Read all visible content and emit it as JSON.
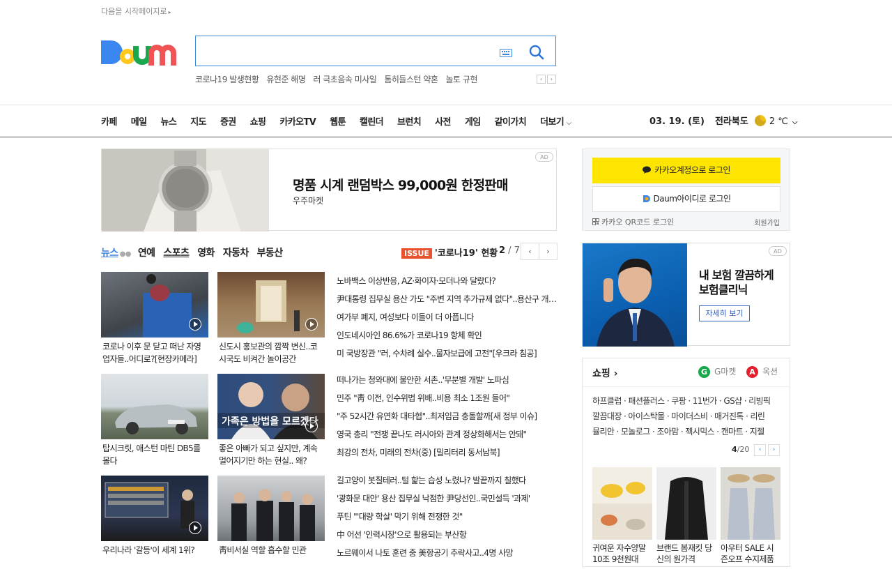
{
  "top": {
    "startpage_link": "다음을 시작페이지로"
  },
  "logo": {
    "text": "Daum"
  },
  "search": {
    "value": "",
    "trending": [
      "코로나19 발생현황",
      "유현준 해명",
      "러 극초음속 미사일",
      "톰히들스턴 약혼",
      "놀토 규현"
    ]
  },
  "gnb": {
    "items": [
      "카페",
      "메일",
      "뉴스",
      "지도",
      "증권",
      "쇼핑",
      "카카오TV",
      "웹툰",
      "캘린더",
      "브런치",
      "사전",
      "게임",
      "같이가치"
    ],
    "more_label": "더보기",
    "date": "03. 19. (토)",
    "region": "전라북도",
    "temp": "2 ℃"
  },
  "banner": {
    "title": "명품 시계 랜덤박스 99,000원 한정판매",
    "sub": "우주마켓",
    "ad_label": "AD"
  },
  "news_tabs": {
    "items": [
      "뉴스",
      "연예",
      "스포츠",
      "영화",
      "자동차",
      "부동산"
    ],
    "issue_badge": "ISSUE",
    "issue_text": "'코로나19' 현황",
    "page_current": "2",
    "page_total": " / 7"
  },
  "thumbs": [
    {
      "caption": "코로나 이후 문 닫고 떠난 자영업자들..어디로?[현장카메라]"
    },
    {
      "caption": "신도시 홍보관의 깜짝 변신..코시국도 비켜간 놀이공간"
    },
    {
      "caption": "탑시크릿, 애스턴 마틴 DB5를 몰다"
    },
    {
      "caption": "좋은 아빠가 되고 싶지만, 계속 멀어지기만 하는 현실.. 왜?"
    },
    {
      "caption": "우리나라 '갈등'이 세계 1위?"
    },
    {
      "caption": "靑비서실 역할 흡수할 민관"
    }
  ],
  "headlines": {
    "group1": [
      "노바백스 이상반응, AZ·화이자·모더나와 달랐다?",
      "尹대통령 집무실 용산 가도 \"주변 지역 추가규제 없다\"..용산구 개발 기대",
      "여가부 폐지, 여성보다 이들이 더 아픕니다",
      "인도네시아인 86.6%가 코로나19 항체 확인",
      "미 국방장관 \"러, 수차례 실수..물자보급에 고전\"[우크라 침공]"
    ],
    "group2": [
      "떠나가는 청와대에 불안한 서촌..'무분별 개발' 노파심",
      "민주 \"靑 이전, 인수위법 위배..비용 최소 1조원 들어\"",
      "\"주 52시간 유연화 대타협\"..최저임금 충돌할까[새 정부 이슈]",
      "영국 총리 \"전쟁 끝나도 러시아와 관계 정상화해서는 안돼\"",
      "최강의 전차, 미래의 전차(중) [밀리터리 동서남북]"
    ],
    "group3": [
      "길고양이 봇질테러..털 핥는 습성 노렸나? 발끝까지 칠했다",
      "'광화문 대안' 용산 집무실 낙점한 尹당선인..국민설득 '과제'",
      "푸틴 \"'대량 학살' 막기 위해 전쟁한 것\"",
      "中 어선 '인력시장'으로 활용되는 부산항",
      "노르웨이서 나토 훈련 중 美항공기 추락사고..4명 사망"
    ]
  },
  "login": {
    "kakao_label": "카카오계정으로 로그인",
    "daum_label": "Daum아이디로 로그인",
    "qr_label": "카카오 QR코드 로그인",
    "signup_label": "회원가입"
  },
  "ins_ad": {
    "title": "내 보험 깔끔하게 보험클리닉",
    "button": "자세히 보기",
    "ad_label": "AD"
  },
  "shopping": {
    "title": "쇼핑",
    "gmarket": "G마켓",
    "auction": "옥션",
    "line1": "하프클럽 · 패션플러스 · 쿠팡 · 11번가 · GS샵 · 리빙픽",
    "line2": "깔끔대장 · 아이스탁몰 · 마이더스비 · 매거진톡 · 리린",
    "line3": "뮬리안 · 모놀로그 · 조아맘 · 젝시믹스 · 캔마트 · 지젤",
    "page_current": "4",
    "page_total": "/20",
    "products": [
      {
        "caption": "귀여운 자수양말 10조 9천원대"
      },
      {
        "caption": "브랜드 봄재킷 당신의 원가격"
      },
      {
        "caption": "아우터 SALE 시즌오프 수지제품"
      }
    ]
  },
  "colors": {
    "accent": "#3b82e0",
    "kakao": "#fee500",
    "issue": "#e8522f"
  }
}
